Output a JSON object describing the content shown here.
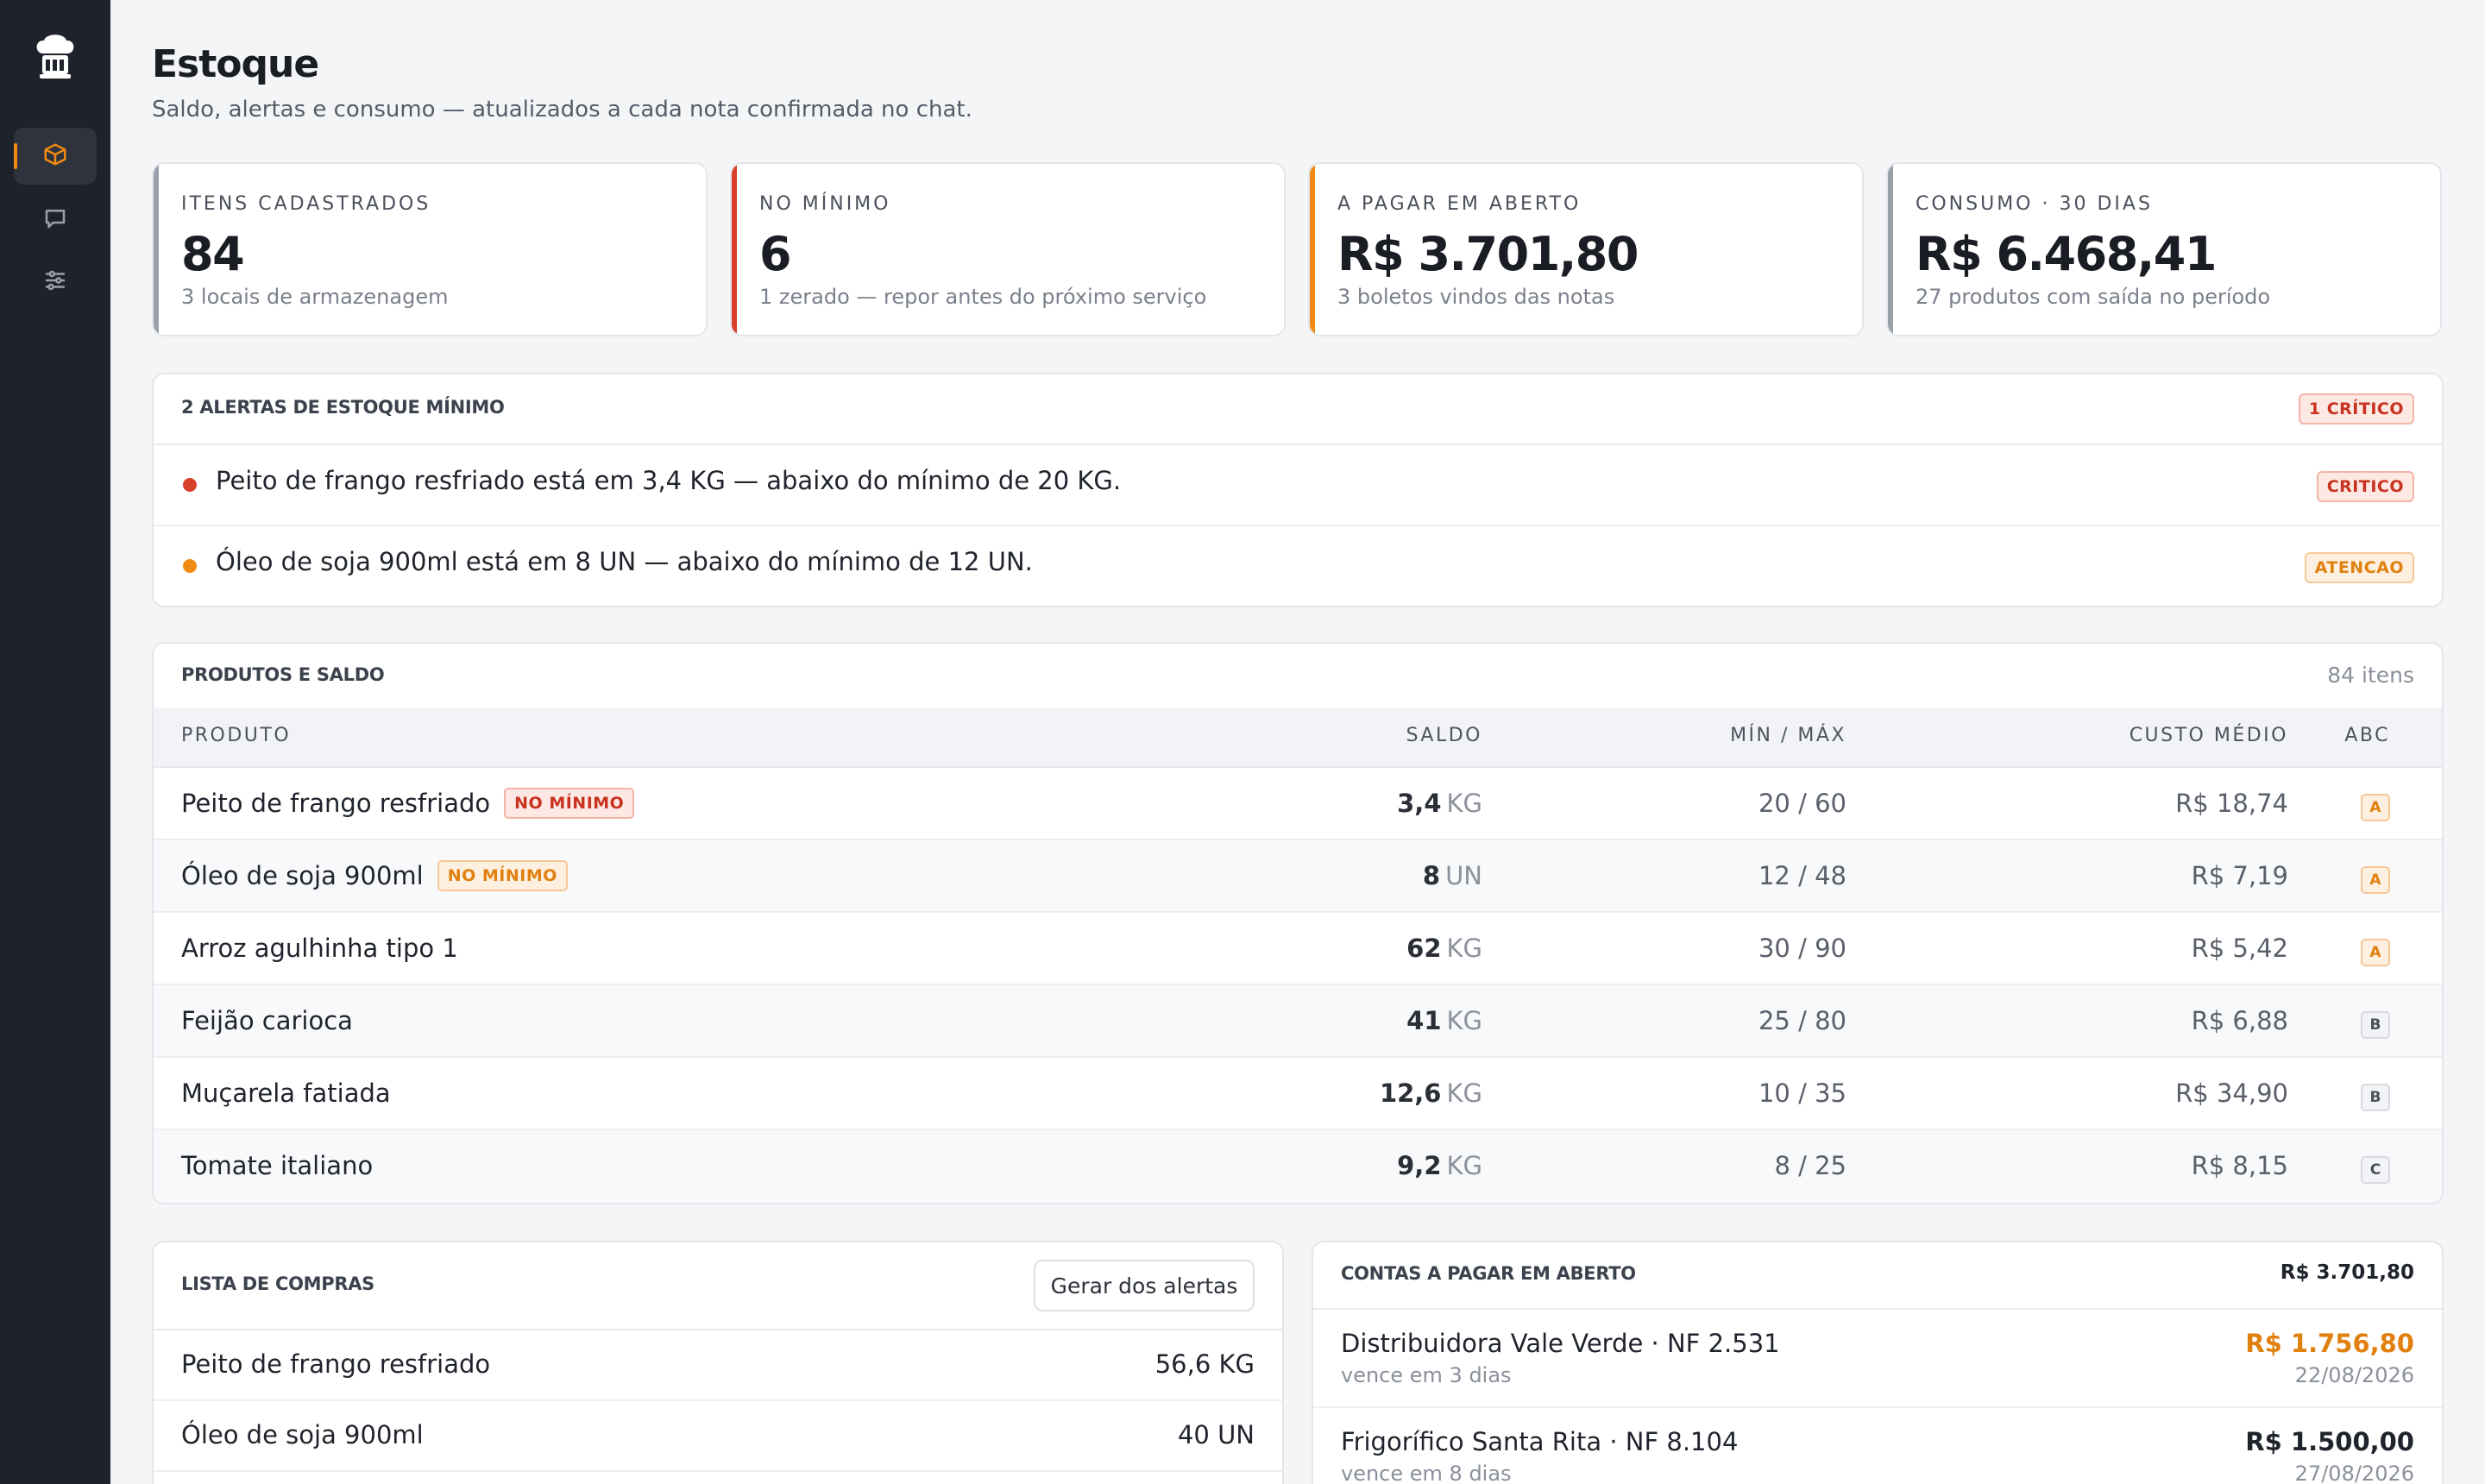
{
  "sidebar": {
    "logo_icon": "chef-hat-logo-icon",
    "items": [
      {
        "icon": "box-icon",
        "active": true
      },
      {
        "icon": "chat-icon",
        "active": false
      },
      {
        "icon": "sliders-icon",
        "active": false
      }
    ],
    "accent": "#f08a12"
  },
  "header": {
    "title": "Estoque",
    "subtitle": "Saldo, alertas e consumo — atualizados a cada nota confirmada no chat."
  },
  "kpis": [
    {
      "label": "Itens cadastrados",
      "value": "84",
      "sub": "3 locais de armazenagem",
      "color": "#9aa0aa"
    },
    {
      "label": "No mínimo",
      "value": "6",
      "sub": "1 zerado — repor antes do próximo serviço",
      "color": "#d9402a"
    },
    {
      "label": "A pagar em aberto",
      "value": "R$ 3.701,80",
      "sub": "3 boletos vindos das notas",
      "color": "#f08a12"
    },
    {
      "label": "Consumo · 30 dias",
      "value": "R$ 6.468,41",
      "sub": "27 produtos com saída no período",
      "color": "#9aa0aa"
    }
  ],
  "alerts": {
    "title": "2 alertas de estoque mínimo",
    "badge": "1 crítico",
    "items": [
      {
        "text": "Peito de frango resfriado está em 3,4 KG — abaixo do mínimo de 20 KG.",
        "badge": "Critico",
        "level": "crit",
        "color": "#d9402a"
      },
      {
        "text": "Óleo de soja 900ml está em 8 UN — abaixo do mínimo de 12 UN.",
        "badge": "Atencao",
        "level": "warn",
        "color": "#f08a12"
      }
    ]
  },
  "products": {
    "title": "Produtos e saldo",
    "count": "84 itens",
    "columns": {
      "produto": "Produto",
      "saldo": "Saldo",
      "minmax": "Mín / Máx",
      "custo": "Custo médio",
      "abc": "ABC"
    },
    "rows": [
      {
        "name": "Peito de frango resfriado",
        "badge": "No mínimo",
        "badge_level": "crit",
        "saldo": "3,4",
        "unit": "KG",
        "minmax": "20 / 60",
        "custo": "R$ 18,74",
        "abc": "A"
      },
      {
        "name": "Óleo de soja 900ml",
        "badge": "No mínimo",
        "badge_level": "warn",
        "saldo": "8",
        "unit": "UN",
        "minmax": "12 / 48",
        "custo": "R$ 7,19",
        "abc": "A"
      },
      {
        "name": "Arroz agulhinha tipo 1",
        "badge": "",
        "badge_level": "",
        "saldo": "62",
        "unit": "KG",
        "minmax": "30 / 90",
        "custo": "R$ 5,42",
        "abc": "A"
      },
      {
        "name": "Feijão carioca",
        "badge": "",
        "badge_level": "",
        "saldo": "41",
        "unit": "KG",
        "minmax": "25 / 80",
        "custo": "R$ 6,88",
        "abc": "B"
      },
      {
        "name": "Muçarela fatiada",
        "badge": "",
        "badge_level": "",
        "saldo": "12,6",
        "unit": "KG",
        "minmax": "10 / 35",
        "custo": "R$ 34,90",
        "abc": "B"
      },
      {
        "name": "Tomate italiano",
        "badge": "",
        "badge_level": "",
        "saldo": "9,2",
        "unit": "KG",
        "minmax": "8 / 25",
        "custo": "R$ 8,15",
        "abc": "C"
      }
    ]
  },
  "shopping": {
    "title": "Lista de compras",
    "button": "Gerar dos alertas",
    "items": [
      {
        "name": "Peito de frango resfriado",
        "qty": "56,6 KG"
      },
      {
        "name": "Óleo de soja 900ml",
        "qty": "40 UN"
      }
    ]
  },
  "payables": {
    "title": "Contas a pagar em aberto",
    "total": "R$ 3.701,80",
    "items": [
      {
        "name": "Distribuidora Vale Verde · NF 2.531",
        "due": "vence em 3 dias",
        "amount": "R$ 1.756,80",
        "date": "22/08/2026",
        "color": "#e0800e"
      },
      {
        "name": "Frigorífico Santa Rita · NF 8.104",
        "due": "vence em 8 dias",
        "amount": "R$ 1.500,00",
        "date": "27/08/2026",
        "color": "#1f232b"
      }
    ]
  }
}
